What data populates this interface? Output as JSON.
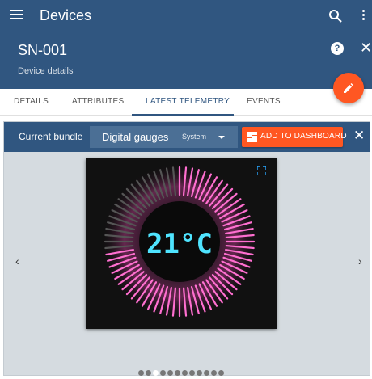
{
  "topbar": {
    "title": "Devices"
  },
  "header": {
    "device_name": "SN-001",
    "subtitle": "Device details"
  },
  "tabs": [
    {
      "label": "DETAILS"
    },
    {
      "label": "ATTRIBUTES"
    },
    {
      "label": "LATEST TELEMETRY",
      "active": true
    },
    {
      "label": "EVENTS"
    }
  ],
  "bundle": {
    "label": "Current bundle",
    "selected": "Digital gauges",
    "scope": "System",
    "add_button": "ADD TO DASHBOARD"
  },
  "widget": {
    "display": "21°C",
    "ring_color": "#ff6fd0"
  },
  "carousel": {
    "page_count": 12,
    "active_index": 2
  },
  "colors": {
    "primary": "#305680",
    "accent": "#ff5722",
    "panel_bg": "#d5dbe0"
  }
}
